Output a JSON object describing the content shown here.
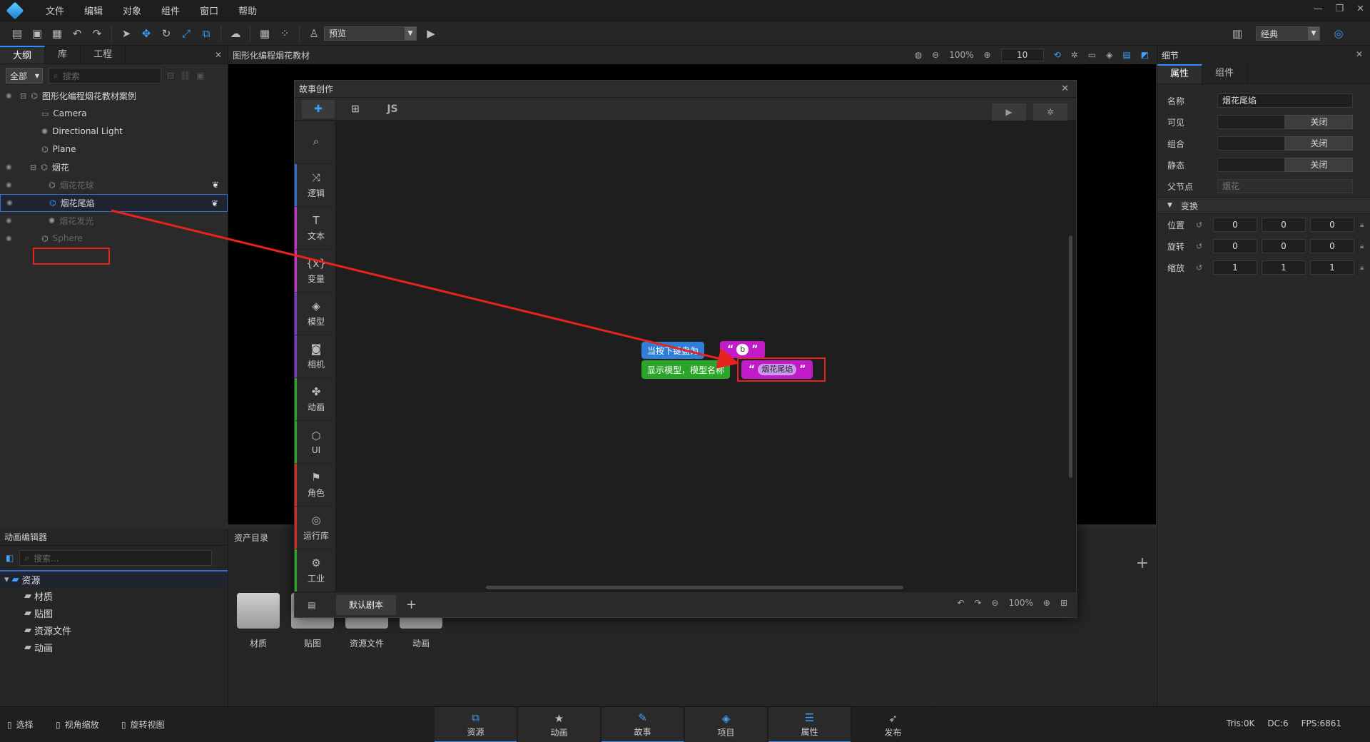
{
  "menu": [
    "文件",
    "编辑",
    "对象",
    "组件",
    "窗口",
    "帮助"
  ],
  "toolbar": {
    "preview_mode": "预览",
    "style_mode": "经典"
  },
  "left_tabs": [
    "大纲",
    "库",
    "工程"
  ],
  "outline": {
    "filter": "全部",
    "search_placeholder": "搜索",
    "items": [
      {
        "label": "图形化编程烟花教材案例",
        "level": 0
      },
      {
        "label": "Camera",
        "level": 1
      },
      {
        "label": "Directional Light",
        "level": 1
      },
      {
        "label": "Plane",
        "level": 1
      },
      {
        "label": "烟花",
        "level": 1
      },
      {
        "label": "烟花花球",
        "level": 2
      },
      {
        "label": "烟花尾焰",
        "level": 2
      },
      {
        "label": "烟花发光",
        "level": 2
      },
      {
        "label": "Sphere",
        "level": 1
      }
    ]
  },
  "scene": {
    "title": "图形化编程烟花教材",
    "zoom": "100%",
    "grid": "10"
  },
  "story": {
    "title": "故事创作",
    "js_tab": "JS",
    "palette": [
      "逻辑",
      "文本",
      "变量",
      "模型",
      "相机",
      "动画",
      "UI",
      "角色",
      "运行库",
      "工业"
    ],
    "block_event": "当按下键盘为",
    "block_event_key": "b",
    "block_show": "显示模型，模型名称",
    "block_show_value": "烟花尾焰",
    "script_tab": "默认剧本",
    "zoom": "100%"
  },
  "details": {
    "title": "细节",
    "tabs": [
      "属性",
      "组件"
    ],
    "name_label": "名称",
    "name_value": "烟花尾焰",
    "visible_label": "可见",
    "group_label": "组合",
    "static_label": "静态",
    "off": "关闭",
    "parent_label": "父节点",
    "parent_value": "烟花",
    "transform": "变换",
    "position_label": "位置",
    "rotation_label": "旋转",
    "scale_label": "缩放",
    "position": [
      "0",
      "0",
      "0"
    ],
    "rotation": [
      "0",
      "0",
      "0"
    ],
    "scale": [
      "1",
      "1",
      "1"
    ]
  },
  "anim": {
    "title": "动画编辑器",
    "search_placeholder": "搜索...",
    "root": "资源",
    "children": [
      "材质",
      "贴图",
      "资源文件",
      "动画"
    ]
  },
  "assets": {
    "tab": "资产目录",
    "items": [
      "材质",
      "贴图",
      "资源文件",
      "动画"
    ]
  },
  "status": {
    "select": "选择",
    "view_zoom": "视角缩放",
    "rotate_view": "旋转视图",
    "tris": "Tris:0K",
    "dc": "DC:6",
    "fps": "FPS:6861",
    "tabs": [
      "资源",
      "动画",
      "故事",
      "项目",
      "属性",
      "发布"
    ]
  }
}
